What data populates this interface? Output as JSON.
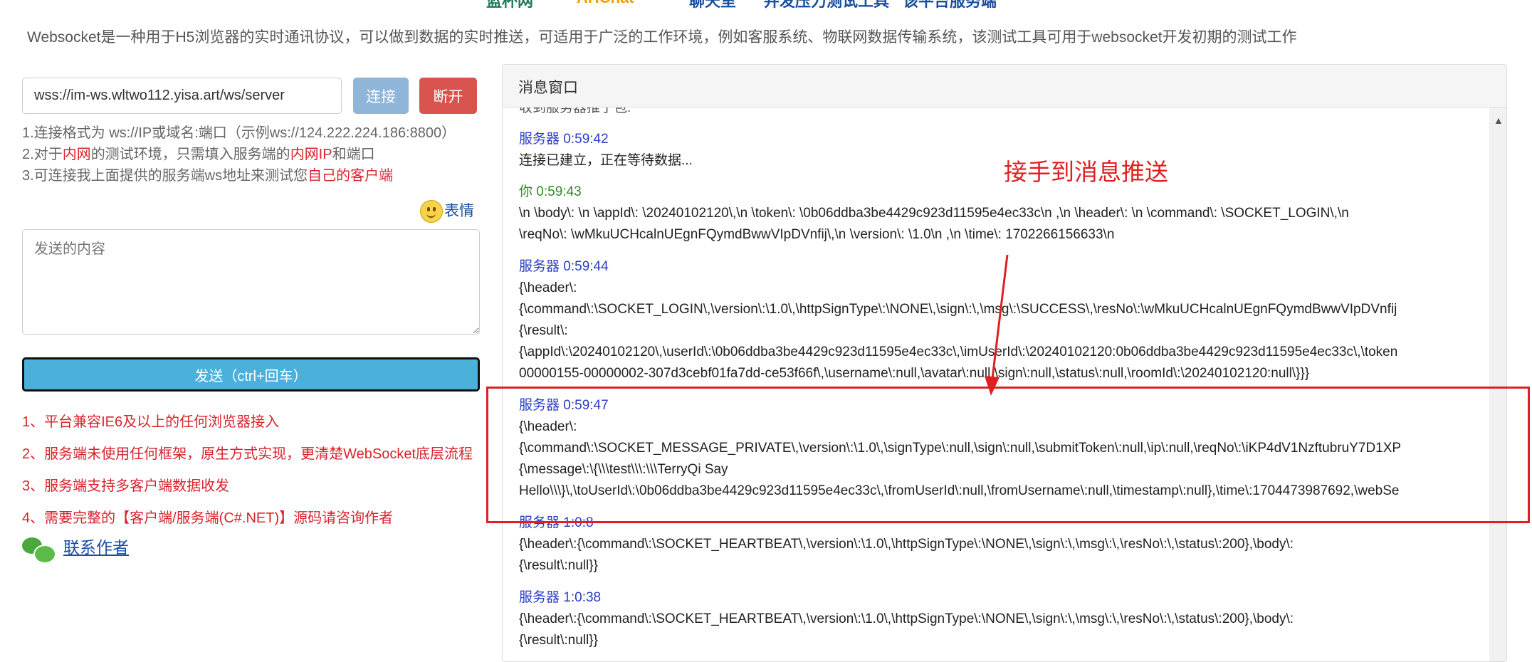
{
  "nav": {
    "items": [
      {
        "label": "蓝杯网",
        "color": "#1f7a58"
      },
      {
        "label": "AHChat",
        "color": "#f0a000"
      },
      {
        "label": "聊天室",
        "color": "#1a4fa0"
      },
      {
        "label": "并发压力测试工具",
        "color": "#1a4fa0"
      },
      {
        "label": "该平台服务端",
        "color": "#1a4fa0"
      }
    ]
  },
  "description": "Websocket是一种用于H5浏览器的实时通讯协议，可以做到数据的实时推送，可适用于广泛的工作环境，例如客服系统、物联网数据传输系统，该测试工具可用于websocket开发初期的测试工作",
  "connection": {
    "url_value": "wss://im-ws.wltwo112.yisa.art/ws/server",
    "connect_label": "连接",
    "disconnect_label": "断开"
  },
  "tips": {
    "line1": "1.连接格式为 ws://IP或域名:端口（示例ws://124.222.224.186:8800）",
    "line2_a": "2.对于",
    "line2_b": "内网",
    "line2_c": "的测试环境，只需填入服务端的",
    "line2_d": "内网IP",
    "line2_e": "和端口",
    "line3_a": "3.可连接我上面提供的服务端ws地址来测试您",
    "line3_b": "自己的客户端"
  },
  "emoji_label": "表情",
  "send": {
    "placeholder": "发送的内容",
    "button_label": "发送（ctrl+回车）"
  },
  "features": [
    "1、平台兼容IE6及以上的任何浏览器接入",
    "2、服务端未使用任何框架，原生方式实现，更清楚WebSocket底层流程",
    "3、服务端支持多客户端数据收发",
    "4、需要完整的【客户端/服务端(C#.NET)】源码请咨询作者"
  ],
  "contact_label": "联系作者",
  "panel": {
    "title": "消息窗口",
    "partial_top": "收到服务器推了包.",
    "messages": [
      {
        "sender": "服务器 0:59:42",
        "lines": [
          "连接已建立，正在等待数据..."
        ]
      },
      {
        "sender": "你 0:59:43",
        "lines": [
          "\\n \\body\\: \\n \\appId\\: \\20240102120\\,\\n \\token\\: \\0b06ddba3be4429c923d11595e4ec33c\\n ,\\n \\header\\: \\n \\command\\: \\SOCKET_LOGIN\\,\\n",
          "\\reqNo\\: \\wMkuUCHcalnUEgnFQymdBwwVIpDVnfij\\,\\n \\version\\: \\1.0\\n ,\\n \\time\\: 1702266156633\\n"
        ]
      },
      {
        "sender": "服务器 0:59:44",
        "lines": [
          "{\\header\\:",
          "{\\command\\:\\SOCKET_LOGIN\\,\\version\\:\\1.0\\,\\httpSignType\\:\\NONE\\,\\sign\\:\\,\\msg\\:\\SUCCESS\\,\\resNo\\:\\wMkuUCHcalnUEgnFQymdBwwVIpDVnfij",
          "{\\result\\:",
          "{\\appId\\:\\20240102120\\,\\userId\\:\\0b06ddba3be4429c923d11595e4ec33c\\,\\imUserId\\:\\20240102120:0b06ddba3be4429c923d11595e4ec33c\\,\\token",
          "00000155-00000002-307d3cebf01fa7dd-ce53f66f\\,\\username\\:null,\\avatar\\:null,\\sign\\:null,\\status\\:null,\\roomId\\:\\20240102120:null\\}}}"
        ]
      },
      {
        "sender": "服务器 0:59:47",
        "lines": [
          "{\\header\\:",
          "{\\command\\:\\SOCKET_MESSAGE_PRIVATE\\,\\version\\:\\1.0\\,\\signType\\:null,\\sign\\:null,\\submitToken\\:null,\\ip\\:null,\\reqNo\\:\\iKP4dV1NzftubruY7D1XP",
          "{\\message\\:\\{\\\\\\test\\\\\\:\\\\\\TerryQi Say",
          "Hello\\\\\\}\\,\\toUserId\\:\\0b06ddba3be4429c923d11595e4ec33c\\,\\fromUserId\\:null,\\fromUsername\\:null,\\timestamp\\:null},\\time\\:1704473987692,\\webSe"
        ]
      },
      {
        "sender": "服务器 1:0:8",
        "lines": [
          "{\\header\\:{\\command\\:\\SOCKET_HEARTBEAT\\,\\version\\:\\1.0\\,\\httpSignType\\:\\NONE\\,\\sign\\:\\,\\msg\\:\\,\\resNo\\:\\,\\status\\:200},\\body\\:",
          "{\\result\\:null}}"
        ]
      },
      {
        "sender": "服务器 1:0:38",
        "lines": [
          "{\\header\\:{\\command\\:\\SOCKET_HEARTBEAT\\,\\version\\:\\1.0\\,\\httpSignType\\:\\NONE\\,\\sign\\:\\,\\msg\\:\\,\\resNo\\:\\,\\status\\:200},\\body\\:",
          "{\\result\\:null}}"
        ]
      }
    ]
  },
  "annotation": {
    "text": "接手到消息推送",
    "color": "#e02020"
  }
}
